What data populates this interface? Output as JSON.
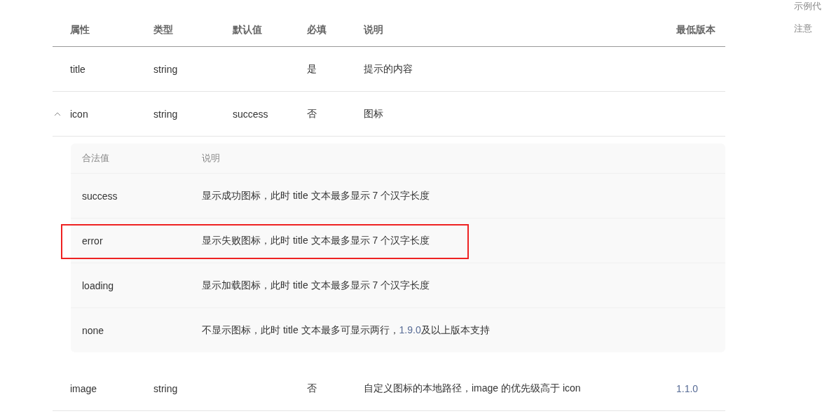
{
  "table": {
    "columns": [
      "属性",
      "类型",
      "默认值",
      "必填",
      "说明",
      "最低版本"
    ],
    "rows": [
      {
        "cells": [
          "title",
          "string",
          "",
          "是",
          "提示的内容",
          ""
        ]
      },
      {
        "cells": [
          "icon",
          "string",
          "success",
          "否",
          "图标",
          ""
        ],
        "expanded": true,
        "values": {
          "columns": [
            "合法值",
            "说明"
          ],
          "rows": [
            {
              "value": "success",
              "description": "显示成功图标，此时 title 文本最多显示 7 个汉字长度",
              "highlighted": false
            },
            {
              "value": "error",
              "description": "显示失败图标，此时 title 文本最多显示 7 个汉字长度",
              "highlighted": true
            },
            {
              "value": "loading",
              "description": "显示加载图标，此时 title 文本最多显示 7 个汉字长度",
              "highlighted": false
            },
            {
              "value": "none",
              "description": "不显示图标，此时 title 文本最多可显示两行，",
              "link": "1.9.0",
              "suffix": "及以上版本支持",
              "highlighted": false
            }
          ]
        }
      },
      {
        "cells": [
          "image",
          "string",
          "",
          "否",
          "自定义图标的本地路径，image 的优先级高于 icon",
          "1.1.0"
        ]
      }
    ]
  },
  "side_nav": [
    "示例代",
    "注意"
  ]
}
